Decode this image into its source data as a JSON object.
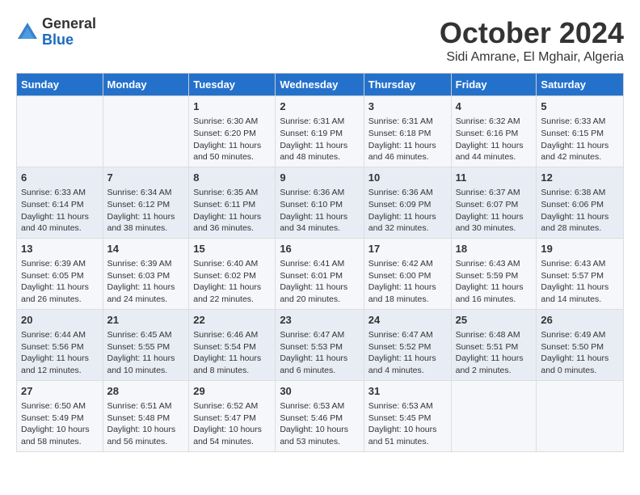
{
  "logo": {
    "general": "General",
    "blue": "Blue"
  },
  "title": "October 2024",
  "location": "Sidi Amrane, El Mghair, Algeria",
  "days_of_week": [
    "Sunday",
    "Monday",
    "Tuesday",
    "Wednesday",
    "Thursday",
    "Friday",
    "Saturday"
  ],
  "weeks": [
    [
      {
        "day": "",
        "content": ""
      },
      {
        "day": "",
        "content": ""
      },
      {
        "day": "1",
        "content": "Sunrise: 6:30 AM\nSunset: 6:20 PM\nDaylight: 11 hours and 50 minutes."
      },
      {
        "day": "2",
        "content": "Sunrise: 6:31 AM\nSunset: 6:19 PM\nDaylight: 11 hours and 48 minutes."
      },
      {
        "day": "3",
        "content": "Sunrise: 6:31 AM\nSunset: 6:18 PM\nDaylight: 11 hours and 46 minutes."
      },
      {
        "day": "4",
        "content": "Sunrise: 6:32 AM\nSunset: 6:16 PM\nDaylight: 11 hours and 44 minutes."
      },
      {
        "day": "5",
        "content": "Sunrise: 6:33 AM\nSunset: 6:15 PM\nDaylight: 11 hours and 42 minutes."
      }
    ],
    [
      {
        "day": "6",
        "content": "Sunrise: 6:33 AM\nSunset: 6:14 PM\nDaylight: 11 hours and 40 minutes."
      },
      {
        "day": "7",
        "content": "Sunrise: 6:34 AM\nSunset: 6:12 PM\nDaylight: 11 hours and 38 minutes."
      },
      {
        "day": "8",
        "content": "Sunrise: 6:35 AM\nSunset: 6:11 PM\nDaylight: 11 hours and 36 minutes."
      },
      {
        "day": "9",
        "content": "Sunrise: 6:36 AM\nSunset: 6:10 PM\nDaylight: 11 hours and 34 minutes."
      },
      {
        "day": "10",
        "content": "Sunrise: 6:36 AM\nSunset: 6:09 PM\nDaylight: 11 hours and 32 minutes."
      },
      {
        "day": "11",
        "content": "Sunrise: 6:37 AM\nSunset: 6:07 PM\nDaylight: 11 hours and 30 minutes."
      },
      {
        "day": "12",
        "content": "Sunrise: 6:38 AM\nSunset: 6:06 PM\nDaylight: 11 hours and 28 minutes."
      }
    ],
    [
      {
        "day": "13",
        "content": "Sunrise: 6:39 AM\nSunset: 6:05 PM\nDaylight: 11 hours and 26 minutes."
      },
      {
        "day": "14",
        "content": "Sunrise: 6:39 AM\nSunset: 6:03 PM\nDaylight: 11 hours and 24 minutes."
      },
      {
        "day": "15",
        "content": "Sunrise: 6:40 AM\nSunset: 6:02 PM\nDaylight: 11 hours and 22 minutes."
      },
      {
        "day": "16",
        "content": "Sunrise: 6:41 AM\nSunset: 6:01 PM\nDaylight: 11 hours and 20 minutes."
      },
      {
        "day": "17",
        "content": "Sunrise: 6:42 AM\nSunset: 6:00 PM\nDaylight: 11 hours and 18 minutes."
      },
      {
        "day": "18",
        "content": "Sunrise: 6:43 AM\nSunset: 5:59 PM\nDaylight: 11 hours and 16 minutes."
      },
      {
        "day": "19",
        "content": "Sunrise: 6:43 AM\nSunset: 5:57 PM\nDaylight: 11 hours and 14 minutes."
      }
    ],
    [
      {
        "day": "20",
        "content": "Sunrise: 6:44 AM\nSunset: 5:56 PM\nDaylight: 11 hours and 12 minutes."
      },
      {
        "day": "21",
        "content": "Sunrise: 6:45 AM\nSunset: 5:55 PM\nDaylight: 11 hours and 10 minutes."
      },
      {
        "day": "22",
        "content": "Sunrise: 6:46 AM\nSunset: 5:54 PM\nDaylight: 11 hours and 8 minutes."
      },
      {
        "day": "23",
        "content": "Sunrise: 6:47 AM\nSunset: 5:53 PM\nDaylight: 11 hours and 6 minutes."
      },
      {
        "day": "24",
        "content": "Sunrise: 6:47 AM\nSunset: 5:52 PM\nDaylight: 11 hours and 4 minutes."
      },
      {
        "day": "25",
        "content": "Sunrise: 6:48 AM\nSunset: 5:51 PM\nDaylight: 11 hours and 2 minutes."
      },
      {
        "day": "26",
        "content": "Sunrise: 6:49 AM\nSunset: 5:50 PM\nDaylight: 11 hours and 0 minutes."
      }
    ],
    [
      {
        "day": "27",
        "content": "Sunrise: 6:50 AM\nSunset: 5:49 PM\nDaylight: 10 hours and 58 minutes."
      },
      {
        "day": "28",
        "content": "Sunrise: 6:51 AM\nSunset: 5:48 PM\nDaylight: 10 hours and 56 minutes."
      },
      {
        "day": "29",
        "content": "Sunrise: 6:52 AM\nSunset: 5:47 PM\nDaylight: 10 hours and 54 minutes."
      },
      {
        "day": "30",
        "content": "Sunrise: 6:53 AM\nSunset: 5:46 PM\nDaylight: 10 hours and 53 minutes."
      },
      {
        "day": "31",
        "content": "Sunrise: 6:53 AM\nSunset: 5:45 PM\nDaylight: 10 hours and 51 minutes."
      },
      {
        "day": "",
        "content": ""
      },
      {
        "day": "",
        "content": ""
      }
    ]
  ]
}
